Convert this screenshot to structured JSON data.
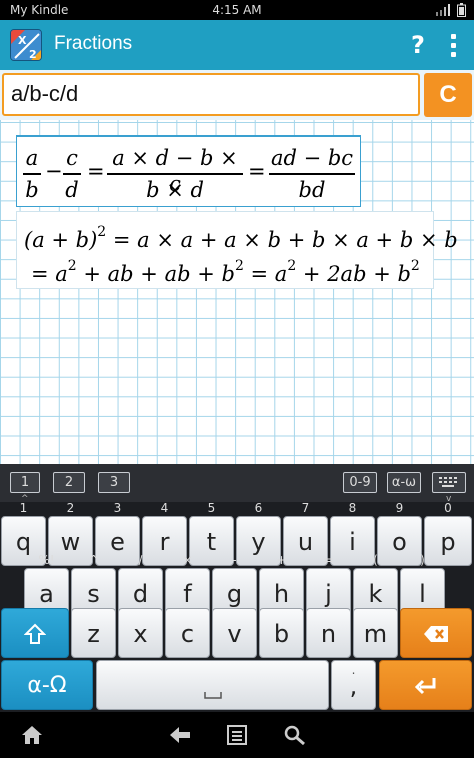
{
  "status_bar": {
    "carrier": "My Kindle",
    "time": "4:15 AM"
  },
  "action_bar": {
    "title": "Fractions",
    "help_label": "?"
  },
  "input": {
    "value": "a/b-c/d",
    "clear_label": "C"
  },
  "result1": {
    "f1_num": "a",
    "f1_den": "b",
    "minus": "−",
    "f2_num": "c",
    "f2_den": "d",
    "eq1": "=",
    "f3_num": "a × d − b × c",
    "f3_den": "b × d",
    "eq2": "=",
    "f4_num": "ad − bc",
    "f4_den": "bd"
  },
  "result2": {
    "line1_left": "(a + b)",
    "line1_exp": "2",
    "line1_right": "= a × a + a × b + b × a + b × b",
    "line2_p1": "= a",
    "line2_e1": "2",
    "line2_p2": " + ab + ab + b",
    "line2_e2": "2",
    "line2_p3": " = a",
    "line2_e3": "2",
    "line2_p4": " + 2ab + b",
    "line2_e4": "2"
  },
  "kb_toolbar": {
    "tab1": "1",
    "tab2": "2",
    "tab3": "3",
    "digits": "0-9",
    "greek": "α-ω"
  },
  "keyboard": {
    "row1": [
      {
        "key": "q",
        "alt": "1"
      },
      {
        "key": "w",
        "alt": "2"
      },
      {
        "key": "e",
        "alt": "3"
      },
      {
        "key": "r",
        "alt": "4"
      },
      {
        "key": "t",
        "alt": "5"
      },
      {
        "key": "y",
        "alt": "6"
      },
      {
        "key": "u",
        "alt": "7"
      },
      {
        "key": "i",
        "alt": "8"
      },
      {
        "key": "o",
        "alt": "9"
      },
      {
        "key": "p",
        "alt": "0"
      }
    ],
    "row2": [
      {
        "key": "a",
        "alt": "%!"
      },
      {
        "key": "s",
        "alt": "^"
      },
      {
        "key": "d",
        "alt": "/"
      },
      {
        "key": "f",
        "alt": "×"
      },
      {
        "key": "g",
        "alt": "-"
      },
      {
        "key": "h",
        "alt": "+"
      },
      {
        "key": "j",
        "alt": "="
      },
      {
        "key": "k",
        "alt": "("
      },
      {
        "key": "l",
        "alt": ")"
      }
    ],
    "row3": [
      "z",
      "x",
      "c",
      "v",
      "b",
      "n",
      "m"
    ],
    "greek_label": "α-Ω",
    "comma": ",",
    "comma_alt": "."
  },
  "colors": {
    "action_bar": "#1f9fc2",
    "accent_orange": "#f39222",
    "grid_line": "#a4d5ea"
  }
}
